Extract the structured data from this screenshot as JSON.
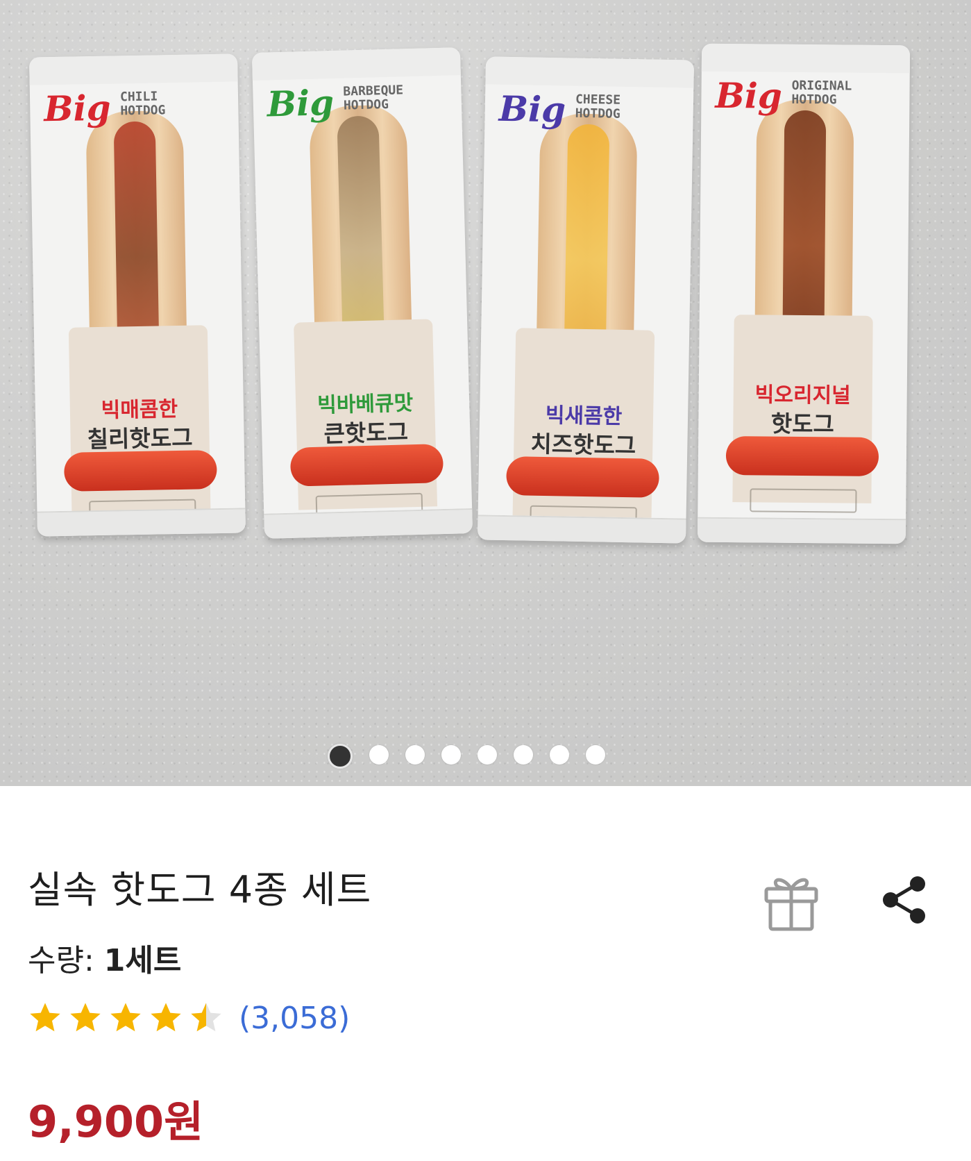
{
  "carousel": {
    "products": [
      {
        "brand": "Big",
        "kind_line1": "CHILI",
        "kind_line2": "HOTDOG",
        "name1": "빅매콤한",
        "name2": "칠리핫도그",
        "brand_color": "#d8262f",
        "name_color": "#d8262f"
      },
      {
        "brand": "Big",
        "kind_line1": "BARBEQUE",
        "kind_line2": "HOTDOG",
        "name1": "빅바베큐맛",
        "name2": "큰핫도그",
        "brand_color": "#2e9a3a",
        "name_color": "#2e9a3a"
      },
      {
        "brand": "Big",
        "kind_line1": "CHEESE",
        "kind_line2": "HOTDOG",
        "name1": "빅새콤한",
        "name2": "치즈핫도그",
        "brand_color": "#4b3aa8",
        "name_color": "#4b3aa8"
      },
      {
        "brand": "Big",
        "kind_line1": "ORIGINAL",
        "kind_line2": "HOTDOG",
        "name1": "빅오리지널",
        "name2": "핫도그",
        "brand_color": "#d8262f",
        "name_color": "#d8262f"
      }
    ],
    "page_count": 8,
    "active_index": 0
  },
  "product": {
    "title": "실속 핫도그 4종 세트",
    "quantity_label": "수량: ",
    "quantity_value": "1세트",
    "rating": 4.5,
    "review_count": "(3,058)",
    "price": "9,900원"
  },
  "colors": {
    "star": "#f7b500",
    "price": "#b5202a",
    "review_link": "#3b6cd6"
  },
  "icons": {
    "gift": "gift-icon",
    "share": "share-icon"
  }
}
